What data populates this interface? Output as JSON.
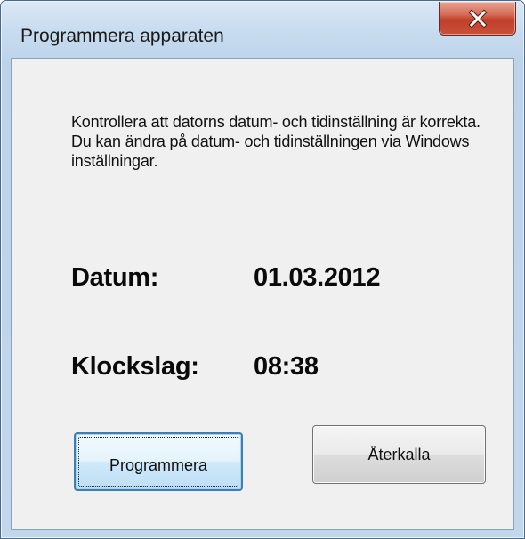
{
  "window": {
    "title": "Programmera apparaten"
  },
  "message": "Kontrollera att datorns datum- och tidinställning är korrekta. Du kan ändra på datum- och tidinställningen via Windows inställningar.",
  "date": {
    "label": "Datum:",
    "value": "01.03.2012"
  },
  "time": {
    "label": "Klockslag:",
    "value": "08:38"
  },
  "buttons": {
    "program_label": "Programmera",
    "cancel_label": "Återkalla"
  },
  "colors": {
    "close_button": "#c7432d",
    "focused_button_border": "#3c7fb1",
    "client_background": "#f0f0f0",
    "frame": "#bcd3ea"
  },
  "icons": {
    "close": "close-icon"
  }
}
